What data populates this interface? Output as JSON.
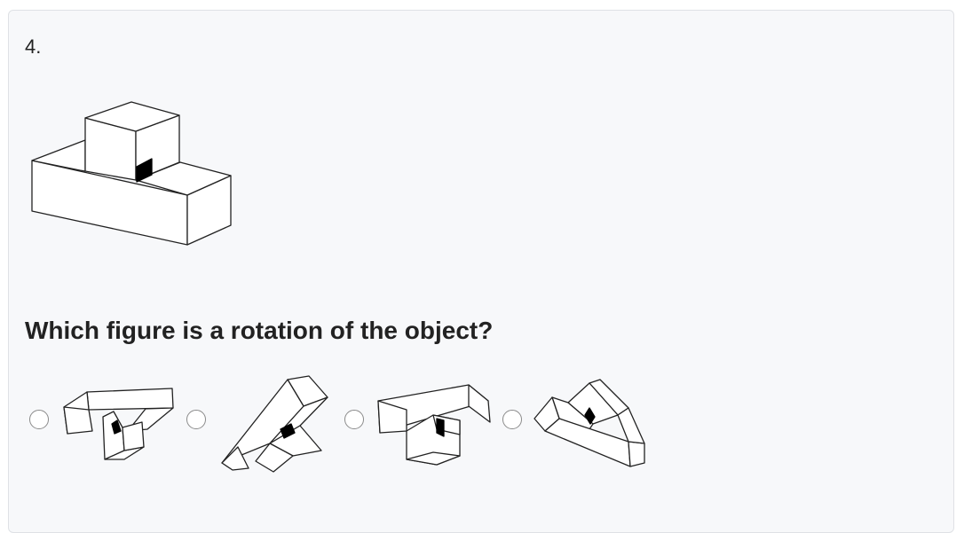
{
  "question": {
    "number": "4.",
    "prompt": "Which figure is a rotation of the object?"
  },
  "object_figure": {
    "icon": "l-shaped-block-figure",
    "marker_color": "#000000"
  },
  "options": [
    {
      "icon": "option-figure-1",
      "selected": false
    },
    {
      "icon": "option-figure-2",
      "selected": false
    },
    {
      "icon": "option-figure-3",
      "selected": false
    },
    {
      "icon": "option-figure-4",
      "selected": false
    }
  ]
}
